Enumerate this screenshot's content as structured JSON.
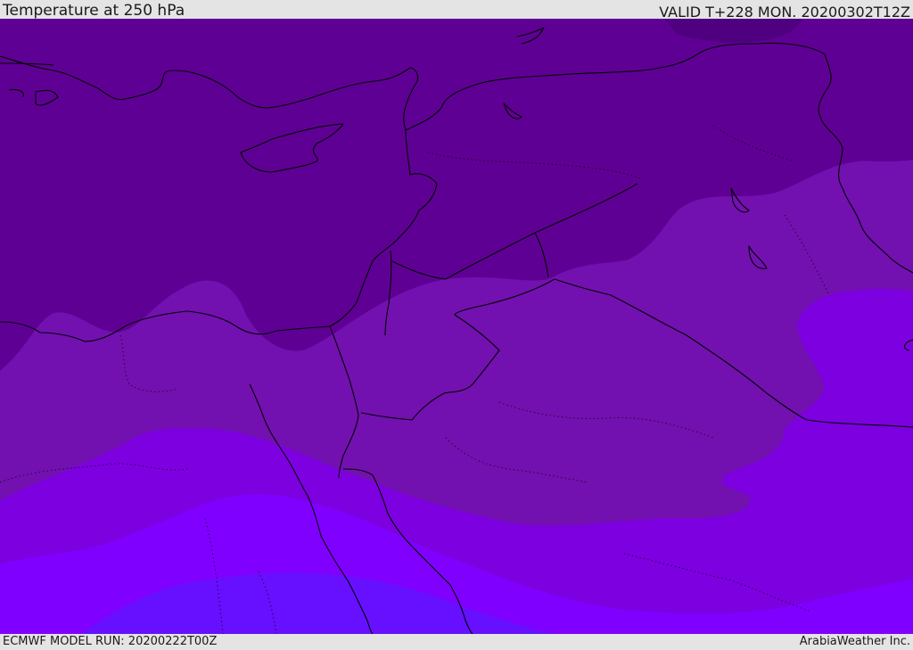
{
  "header": {
    "title": "Temperature at 250 hPa",
    "valid": "VALID T+228 MON. 20200302T12Z"
  },
  "footer": {
    "model_run": "ECMWF MODEL RUN: 20200222T00Z",
    "credit": "ArabiaWeather Inc."
  },
  "map": {
    "field": "temperature-250hpa",
    "colors": {
      "band_darkest": "#5f0094",
      "band_dark_cap": "#4f0080",
      "band_mid": "#7211af",
      "band_bright": "#7d00e0",
      "band_brighter": "#8000ff",
      "band_blue": "#6610ff",
      "coastline": "#000000"
    }
  }
}
